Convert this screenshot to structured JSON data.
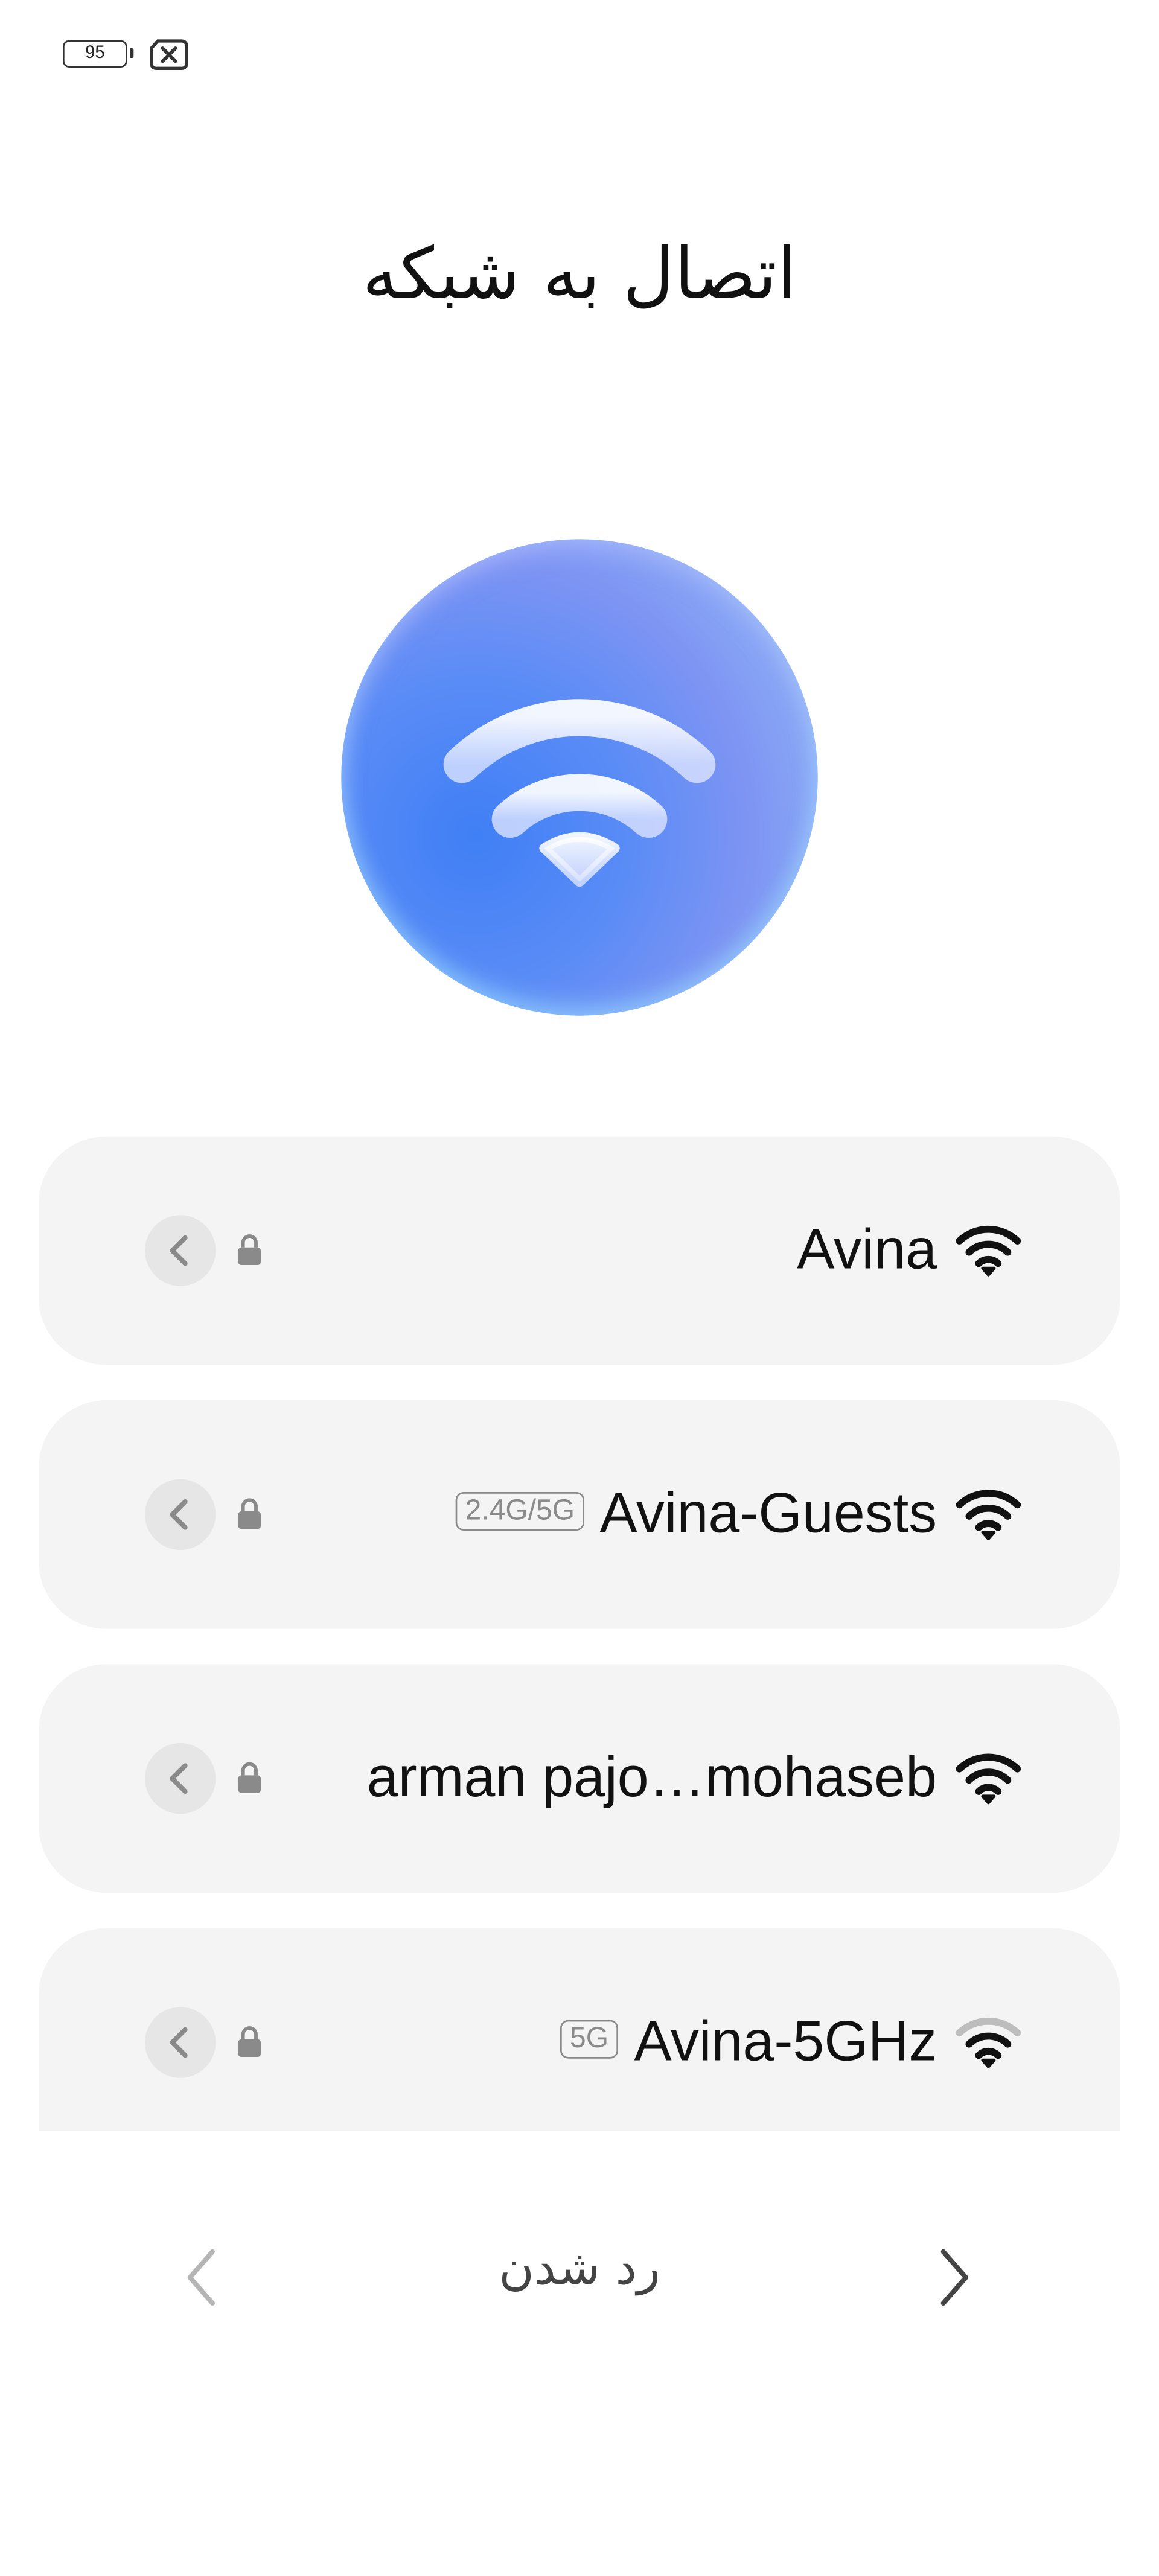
{
  "status_bar": {
    "battery_level": "95",
    "battery_icon": "battery-icon",
    "sim_icon": "no-sim-icon"
  },
  "title": "اتصال به شبکه",
  "hero_icon": "wifi-icon",
  "networks": [
    {
      "name": "Avina",
      "band": "",
      "secured": true,
      "signal_level": 4
    },
    {
      "name": "Avina-Guests",
      "band": "2.4G/5G",
      "secured": true,
      "signal_level": 4
    },
    {
      "name": "arman pajo…mohaseb",
      "band": "",
      "secured": true,
      "signal_level": 4
    },
    {
      "name": "Avina-5GHz",
      "band": "5G",
      "secured": true,
      "signal_level": 3
    }
  ],
  "navigation": {
    "prev_icon": "chevron-left-icon",
    "skip_label": "رد شدن",
    "next_icon": "chevron-right-icon"
  },
  "colors": {
    "card_background": "#f4f4f4",
    "hero_blue": "#4f86f5",
    "badge_gray": "#8a8a8a",
    "text": "#111111"
  }
}
